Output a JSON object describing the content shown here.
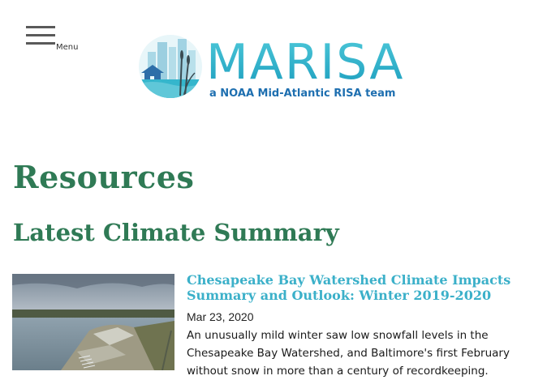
{
  "menu": {
    "label": "Menu"
  },
  "logo": {
    "wordmark": "MARISA",
    "tagline": "a NOAA Mid-Atlantic RISA team"
  },
  "page": {
    "title": "Resources",
    "section_title": "Latest Climate Summary"
  },
  "article": {
    "title": "Chesapeake Bay Watershed Climate Impacts Summary and Outlook: Winter 2019-2020",
    "date": "Mar 23, 2020",
    "summary": "An unusually mild winter saw low snowfall levels in the Chesapeake Bay Watershed, and Baltimore's first February without snow in more than a century of recordkeeping."
  },
  "colors": {
    "heading_green": "#2f7a55",
    "link_teal": "#3bb0c9",
    "logo_teal": "#1fb2c9",
    "logo_blue": "#1e6fb0"
  },
  "icons": {
    "menu": "hamburger-icon",
    "logo_emblem": "city-marsh-emblem-icon"
  }
}
